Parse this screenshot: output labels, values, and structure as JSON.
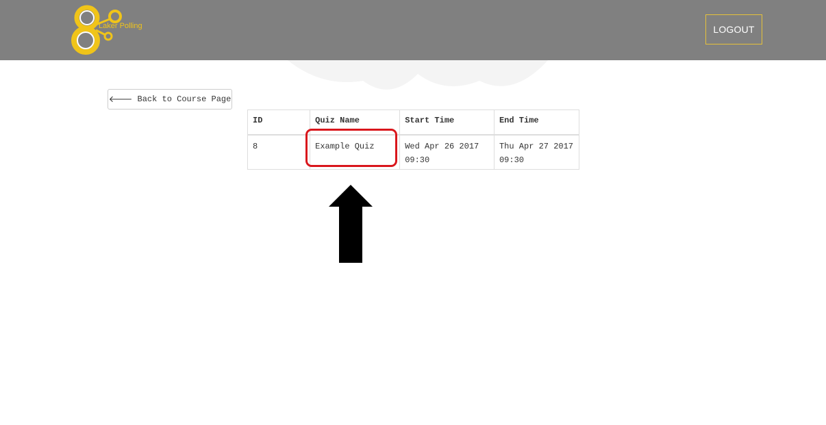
{
  "header": {
    "logo_text": "Laker Polling",
    "logout_label": "LOGOUT"
  },
  "navigation": {
    "back_label": "Back to Course Page",
    "back_icon": "arrow-left-icon"
  },
  "quiz_table": {
    "columns": [
      "ID",
      "Quiz Name",
      "Start Time",
      "End Time"
    ],
    "rows": [
      {
        "id": "8",
        "name": "Example Quiz",
        "start": "Wed Apr 26 2017 09:30",
        "end": "Thu Apr 27 2017 09:30"
      }
    ]
  },
  "annotation": {
    "highlight_color": "#d9161c",
    "arrow_color": "#000000"
  },
  "colors": {
    "header_bg": "#808080",
    "accent": "#f0c419"
  }
}
